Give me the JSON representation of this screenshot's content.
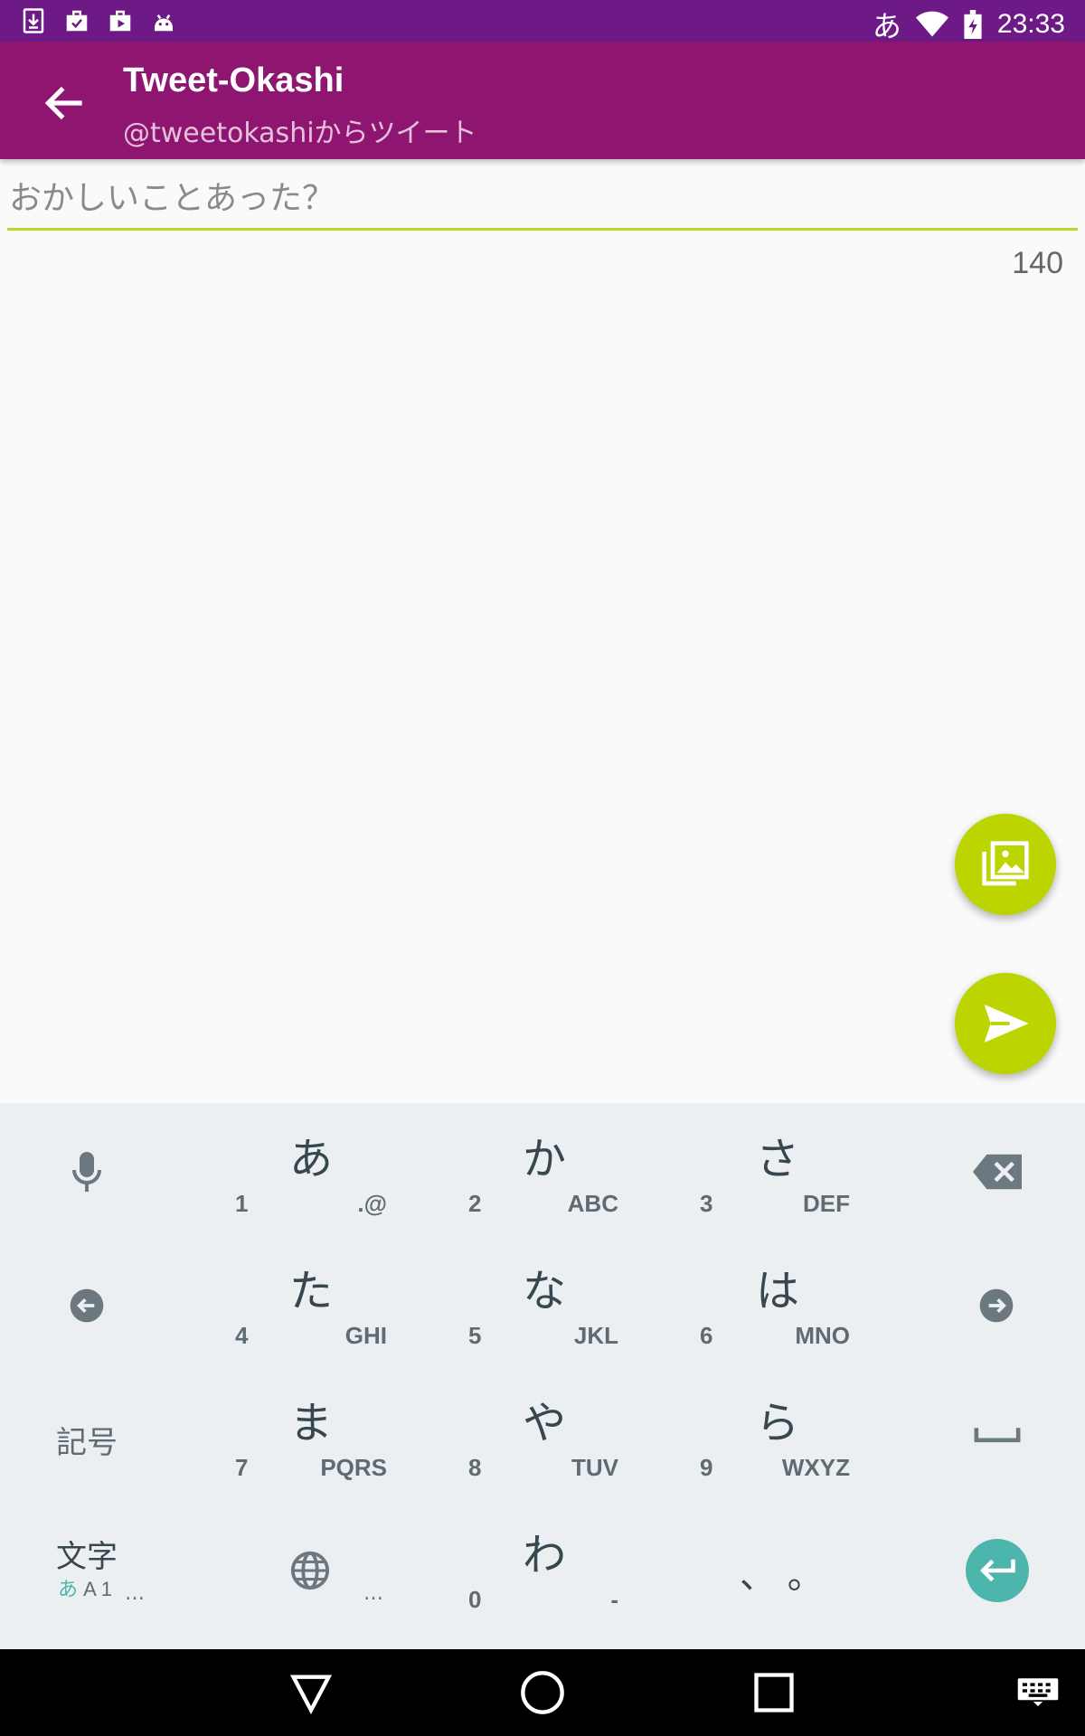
{
  "status_bar": {
    "ime_indicator": "あ",
    "time": "23:33",
    "notification_icons": [
      "download-icon",
      "clipboard-check-icon",
      "play-store-icon",
      "android-debug-icon"
    ]
  },
  "app_bar": {
    "title": "Tweet-Okashi",
    "subtitle": "@tweetokashiからツイート"
  },
  "compose": {
    "placeholder": "おかしいことあった？",
    "value": "",
    "char_counter": "140"
  },
  "fabs": [
    "image-gallery-icon",
    "send-icon"
  ],
  "keyboard": {
    "rows": [
      [
        {
          "kana": "あ",
          "num": "1",
          "alpha": ".@"
        },
        {
          "kana": "か",
          "num": "2",
          "alpha": "ABC"
        },
        {
          "kana": "さ",
          "num": "3",
          "alpha": "DEF"
        }
      ],
      [
        {
          "kana": "た",
          "num": "4",
          "alpha": "GHI"
        },
        {
          "kana": "な",
          "num": "5",
          "alpha": "JKL"
        },
        {
          "kana": "は",
          "num": "6",
          "alpha": "MNO"
        }
      ],
      [
        {
          "kana": "ま",
          "num": "7",
          "alpha": "PQRS"
        },
        {
          "kana": "や",
          "num": "8",
          "alpha": "TUV"
        },
        {
          "kana": "ら",
          "num": "9",
          "alpha": "WXYZ"
        }
      ]
    ],
    "bottom_row": {
      "wa_kana": "わ",
      "wa_num": "0",
      "wa_alpha": "-",
      "punct": "、 。",
      "ellipsis": "…"
    },
    "kigou_label": "記号",
    "moji_label": "文字",
    "moji_sub_a": "あ",
    "moji_sub_rest": "A 1"
  },
  "colors": {
    "status_bar": "#6e1a86",
    "app_bar": "#8e1670",
    "accent": "#bcd400",
    "enter": "#4db6ac"
  }
}
